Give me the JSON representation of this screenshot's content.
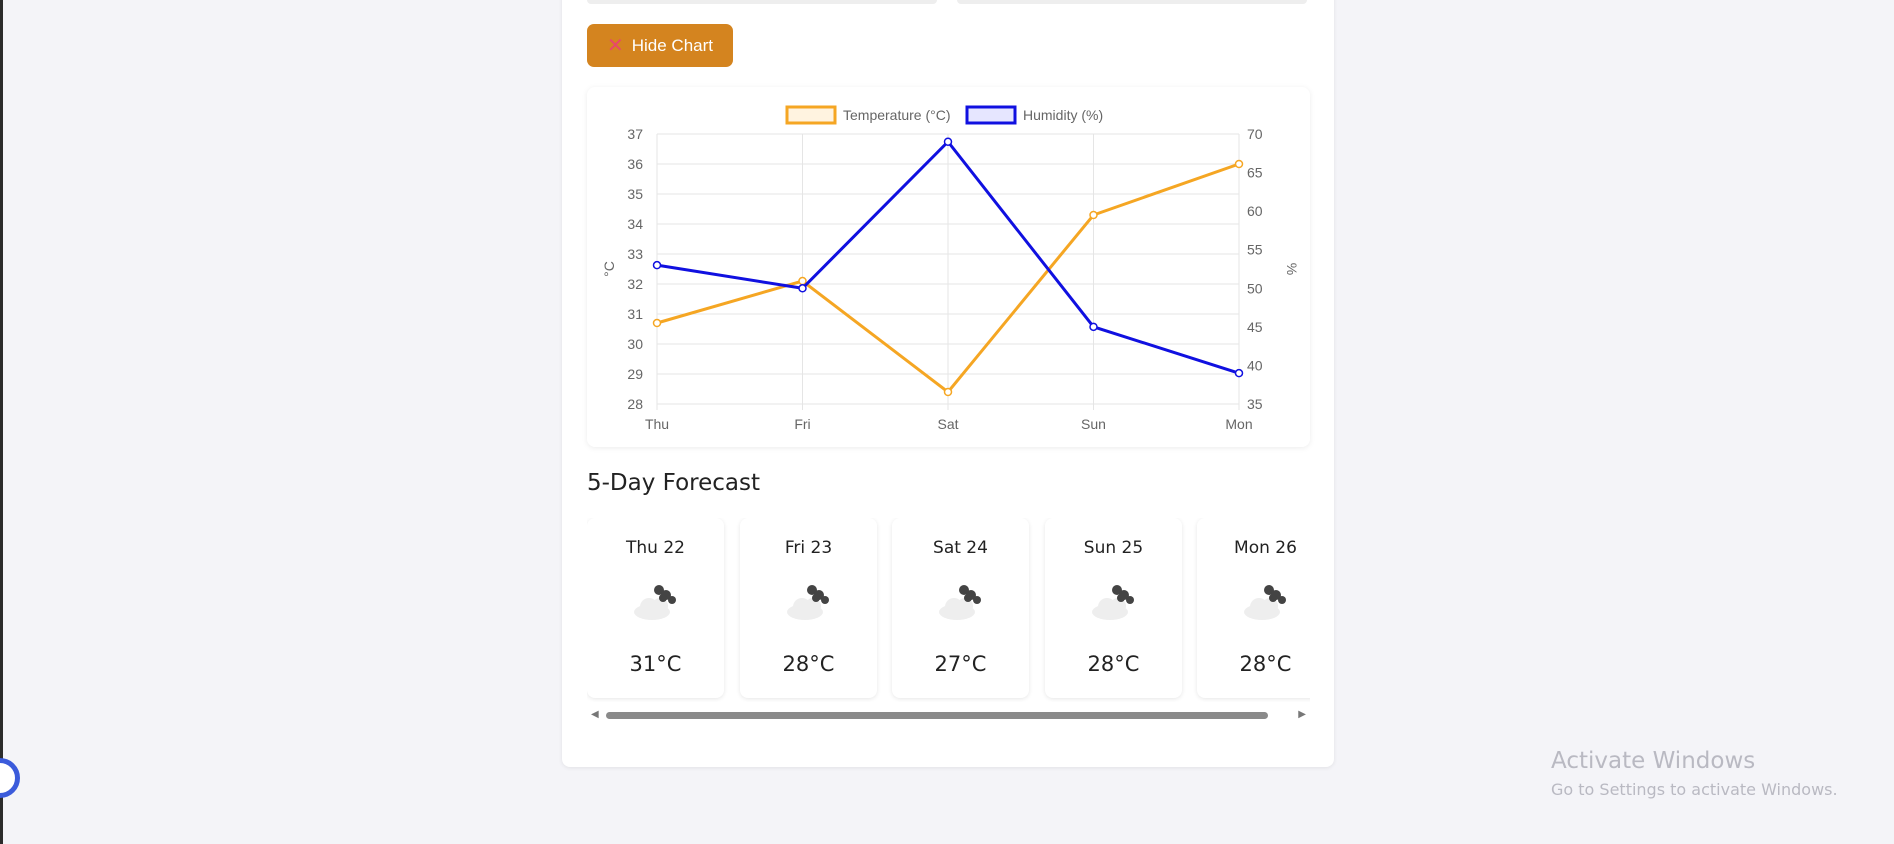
{
  "toolbar": {
    "hide_chart_label": "Hide Chart",
    "hide_chart_icon": "x-icon"
  },
  "chart_data": {
    "type": "line",
    "x": [
      "Thu",
      "Fri",
      "Sat",
      "Sun",
      "Mon"
    ],
    "series": [
      {
        "name": "Temperature (°C)",
        "values": [
          30.7,
          32.1,
          28.4,
          34.3,
          36
        ],
        "color": "#f5a623",
        "axis": "left"
      },
      {
        "name": "Humidity (%)",
        "values": [
          53,
          50,
          69,
          45,
          39
        ],
        "color": "#1010e0",
        "axis": "right"
      }
    ],
    "y_left": {
      "label": "°C",
      "ylim": [
        28,
        37
      ],
      "ticks": [
        "28",
        "29",
        "30",
        "31",
        "32",
        "33",
        "34",
        "35",
        "36",
        "37"
      ]
    },
    "y_right": {
      "label": "%",
      "ylim": [
        35,
        70
      ],
      "ticks": [
        "35",
        "40",
        "45",
        "50",
        "55",
        "60",
        "65",
        "70"
      ]
    },
    "legend": "top",
    "grid": true
  },
  "forecast": {
    "title": "5-Day Forecast",
    "days": [
      {
        "day": "Thu 22",
        "temp": "31°C",
        "icon": "cloud-icon"
      },
      {
        "day": "Fri 23",
        "temp": "28°C",
        "icon": "cloud-icon"
      },
      {
        "day": "Sat 24",
        "temp": "27°C",
        "icon": "cloud-icon"
      },
      {
        "day": "Sun 25",
        "temp": "28°C",
        "icon": "cloud-icon"
      },
      {
        "day": "Mon 26",
        "temp": "28°C",
        "icon": "cloud-icon"
      }
    ]
  },
  "watermark": {
    "title": "Activate Windows",
    "subtitle": "Go to Settings to activate Windows."
  }
}
